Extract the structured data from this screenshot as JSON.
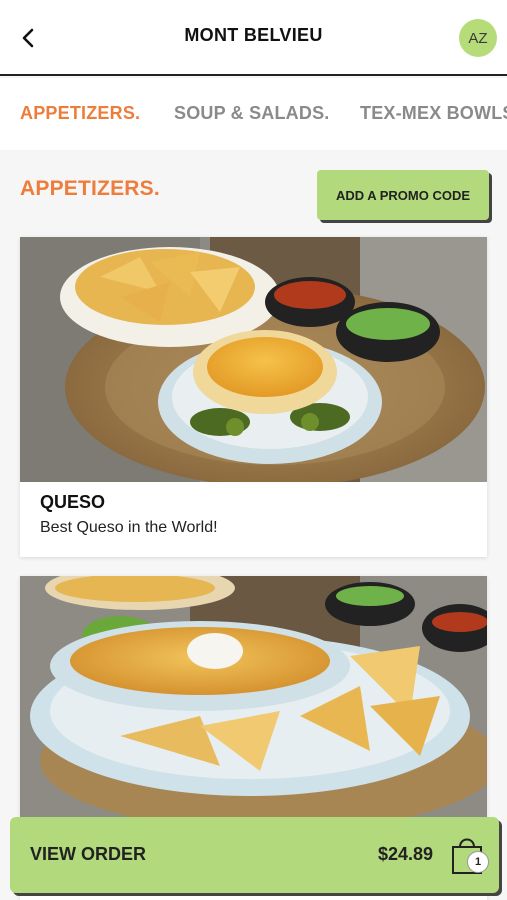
{
  "header": {
    "title": "MONT BELVIEU",
    "avatar_initials": "AZ",
    "back_icon": "chevron-left-icon"
  },
  "tabs": [
    {
      "label": "APPETIZERS.",
      "active": true
    },
    {
      "label": "SOUP & SALADS.",
      "active": false
    },
    {
      "label": "TEX-MEX BOWLS",
      "active": false
    }
  ],
  "section": {
    "title": "APPETIZERS.",
    "promo_label": "ADD A PROMO CODE"
  },
  "items": [
    {
      "name": "QUESO",
      "description": "Best Queso in the World!",
      "image": "queso-photo"
    },
    {
      "name": "",
      "description": "",
      "image": "nachos-dip-photo"
    }
  ],
  "order": {
    "label": "VIEW ORDER",
    "total": "$24.89",
    "count": "1",
    "icon": "shopping-bag-icon"
  },
  "colors": {
    "accent_orange": "#ee7d3b",
    "accent_green": "#b2d97b",
    "avatar_green": "#b6dc7a"
  }
}
